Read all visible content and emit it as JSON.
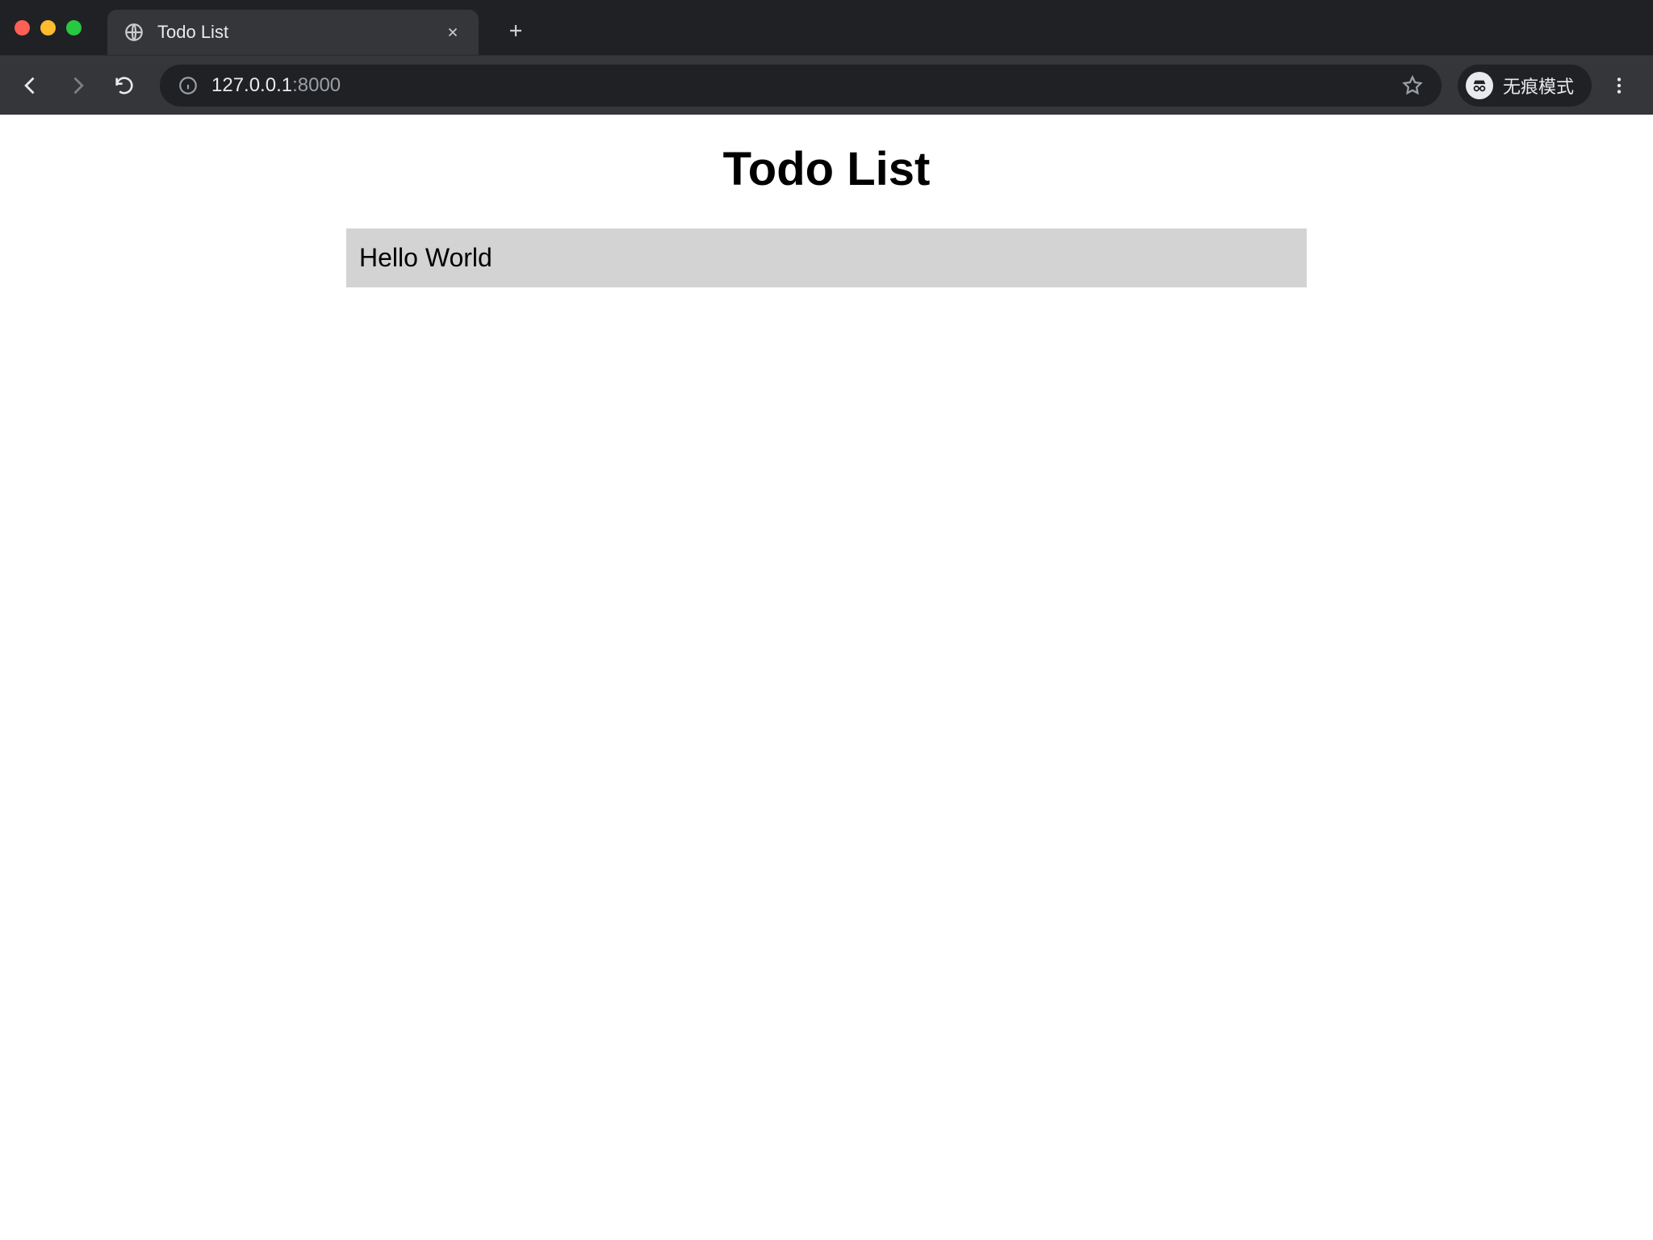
{
  "browser": {
    "tab_title": "Todo List",
    "url_host": "127.0.0.1",
    "url_port": ":8000",
    "incognito_label": "无痕模式"
  },
  "page": {
    "heading": "Todo List",
    "todos": [
      {
        "text": "Hello World"
      }
    ]
  }
}
